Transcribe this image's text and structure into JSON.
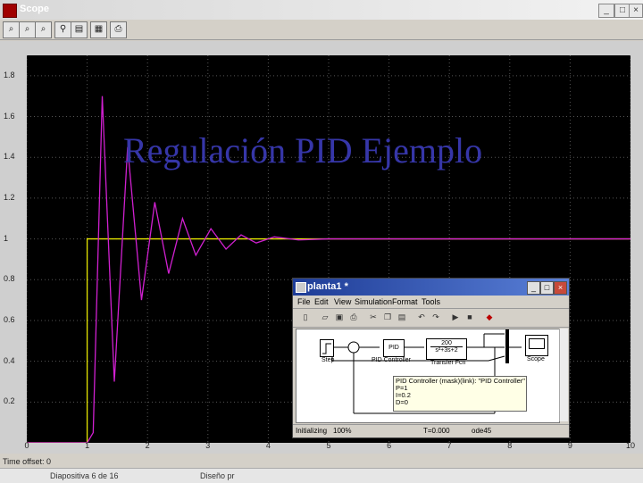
{
  "window": {
    "title": "Scope"
  },
  "toolbar": {
    "buttons": [
      "zoom-in",
      "zoom-x",
      "zoom-y",
      "autoscale",
      "save-axes",
      "restore-axes",
      "print"
    ]
  },
  "chart_data": {
    "type": "line",
    "xlim": [
      0,
      10
    ],
    "ylim": [
      0,
      1.9
    ],
    "x_ticks": [
      "0",
      "1",
      "2",
      "3",
      "4",
      "5",
      "6",
      "7",
      "8",
      "9",
      "10"
    ],
    "y_ticks": [
      "0.2",
      "0.4",
      "0.6",
      "0.8",
      "1",
      "1.2",
      "1.4",
      "1.6",
      "1.8"
    ],
    "grid": true,
    "series": [
      {
        "color": "#e6e600",
        "x": [
          0,
          1,
          1,
          10
        ],
        "y": [
          0,
          0,
          1,
          1
        ]
      },
      {
        "color": "#d020d0",
        "x": [
          0,
          1,
          1.1,
          1.25,
          1.45,
          1.67,
          1.9,
          2.12,
          2.35,
          2.58,
          2.8,
          3.05,
          3.3,
          3.55,
          3.8,
          4.1,
          4.5,
          5,
          6,
          7,
          8,
          9,
          10
        ],
        "y": [
          0,
          0,
          0.05,
          1.7,
          0.3,
          1.45,
          0.7,
          1.18,
          0.83,
          1.1,
          0.92,
          1.05,
          0.95,
          1.02,
          0.98,
          1.01,
          0.995,
          1.0,
          1.0,
          1.0,
          1.0,
          1.0,
          1.0
        ]
      }
    ]
  },
  "time_offset": {
    "label": "Time offset:",
    "value": "0"
  },
  "slide_title": "Regulación PID Ejemplo",
  "simulink": {
    "title": "planta1 *",
    "menu": [
      "File",
      "Edit",
      "View",
      "Simulation",
      "Format",
      "Tools"
    ],
    "blocks": {
      "step": "Step",
      "pid": "PID",
      "pid_label": "PID Controller",
      "tf_num": "200",
      "tf_den": "s²+3s+2",
      "tf_label": "Transfer Fcn",
      "scope": "Scope"
    },
    "tooltip": [
      "PID Controller (mask)(link): \"PID Controller\"",
      "P=1",
      "I=0.2",
      "D=0"
    ],
    "status": {
      "state": "Initializing",
      "zoom": "100%",
      "time": "T=0.000",
      "solver": "ode45"
    }
  },
  "status_bar": {
    "slide": "Diapositiva 6 de 16",
    "design": "Diseño pr"
  }
}
